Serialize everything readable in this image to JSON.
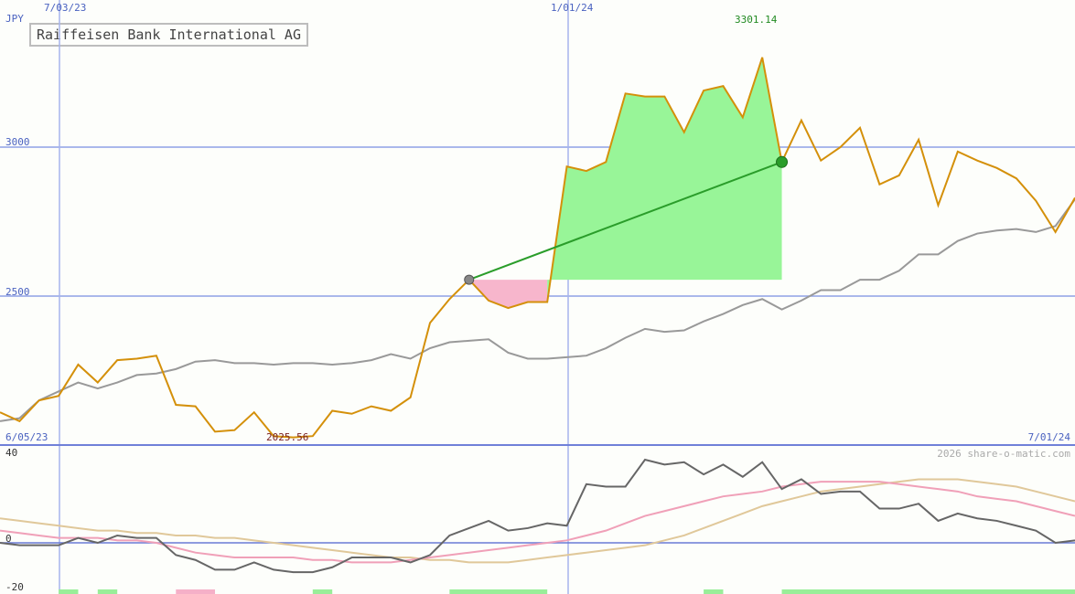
{
  "chart_data": [
    {
      "type": "line",
      "title": "Raiffeisen Bank International AG",
      "currency_label": "JPY",
      "date_range_start": "6/05/23",
      "date_range_end": "7/01/24",
      "x_ticks": [
        "7/03/23",
        "1/01/24"
      ],
      "y_ticks": [
        2500,
        3000
      ],
      "ylim": [
        2000,
        3500
      ],
      "grid": true,
      "annotations": {
        "high_label": "3301.14",
        "low_label": "2025.56",
        "copyright": "2026 share-o-matic.com"
      },
      "series": [
        {
          "name": "",
          "color": "#d4900a",
          "values": [
            2110,
            2080,
            2150,
            2165,
            2270,
            2210,
            2285,
            2290,
            2300,
            2135,
            2130,
            2045,
            2050,
            2110,
            2030,
            2025.56,
            2030,
            2115,
            2105,
            2130,
            2115,
            2160,
            2410,
            2490,
            2555,
            2485,
            2460,
            2480,
            2480,
            2935,
            2920,
            2950,
            3180,
            3170,
            3170,
            3050,
            3190,
            3205,
            3100,
            3301.14,
            2950,
            3090,
            2955,
            3000,
            3065,
            2875,
            2905,
            3025,
            2805,
            2985,
            2955,
            2930,
            2895,
            2820,
            2715,
            2830
          ]
        },
        {
          "name": "",
          "color": "#999999",
          "values": [
            2080,
            2090,
            2150,
            2180,
            2210,
            2190,
            2210,
            2235,
            2240,
            2255,
            2280,
            2285,
            2275,
            2275,
            2270,
            2275,
            2275,
            2270,
            2275,
            2285,
            2305,
            2290,
            2325,
            2345,
            2350,
            2355,
            2310,
            2290,
            2290,
            2295,
            2300,
            2325,
            2360,
            2390,
            2380,
            2385,
            2415,
            2440,
            2470,
            2490,
            2455,
            2485,
            2520,
            2520,
            2555,
            2555,
            2585,
            2640,
            2640,
            2685,
            2710,
            2720,
            2725,
            2715,
            2735,
            2825
          ]
        }
      ],
      "trade": {
        "entry_index": 24,
        "entry_value": 2555,
        "exit_index": 40,
        "exit_value": 2950,
        "color": "#2a9d2a"
      }
    },
    {
      "type": "line",
      "y_ticks": [
        40,
        0,
        -20
      ],
      "ylim": [
        -20,
        40
      ],
      "series": [
        {
          "name": "",
          "color": "#666666",
          "values": [
            0,
            -1,
            -1,
            -1,
            2,
            0,
            3,
            2,
            2,
            -5,
            -7,
            -11,
            -11,
            -8,
            -11,
            -12,
            -12,
            -10,
            -6,
            -6,
            -6,
            -8,
            -5,
            3,
            6,
            9,
            5,
            6,
            8,
            7,
            24,
            23,
            23,
            34,
            32,
            33,
            28,
            32,
            27,
            33,
            22,
            26,
            20,
            21,
            21,
            14,
            14,
            16,
            9,
            12,
            10,
            9,
            7,
            5,
            0,
            1
          ]
        },
        {
          "name": "",
          "color": "#f0a0b8",
          "values": [
            5,
            4,
            3,
            2,
            2,
            2,
            1,
            1,
            0,
            -2,
            -4,
            -5,
            -6,
            -6,
            -6,
            -6,
            -7,
            -7,
            -8,
            -8,
            -8,
            -7,
            -6,
            -5,
            -4,
            -3,
            -2,
            -1,
            0,
            1,
            3,
            5,
            8,
            11,
            13,
            15,
            17,
            19,
            20,
            21,
            23,
            24,
            25,
            25,
            25,
            25,
            24,
            23,
            22,
            21,
            19,
            18,
            17,
            15,
            13,
            11
          ]
        },
        {
          "name": "",
          "color": "#e0c89a",
          "values": [
            10,
            9,
            8,
            7,
            6,
            5,
            5,
            4,
            4,
            3,
            3,
            2,
            2,
            1,
            0,
            -1,
            -2,
            -3,
            -4,
            -5,
            -6,
            -6,
            -7,
            -7,
            -8,
            -8,
            -8,
            -7,
            -6,
            -5,
            -4,
            -3,
            -2,
            -1,
            1,
            3,
            6,
            9,
            12,
            15,
            17,
            19,
            21,
            22,
            23,
            24,
            25,
            26,
            26,
            26,
            25,
            24,
            23,
            21,
            19,
            17
          ]
        }
      ],
      "volume_bars": [
        {
          "from_index": 3,
          "to_index": 4,
          "color": "#99ee99"
        },
        {
          "from_index": 5,
          "to_index": 6,
          "color": "#99ee99"
        },
        {
          "from_index": 9,
          "to_index": 11,
          "color": "#f5b0c8"
        },
        {
          "from_index": 16,
          "to_index": 17,
          "color": "#99ee99"
        },
        {
          "from_index": 23,
          "to_index": 28,
          "color": "#99ee99"
        },
        {
          "from_index": 36,
          "to_index": 37,
          "color": "#99ee99"
        },
        {
          "from_index": 40,
          "to_index": 55,
          "color": "#99ee99"
        }
      ]
    }
  ]
}
